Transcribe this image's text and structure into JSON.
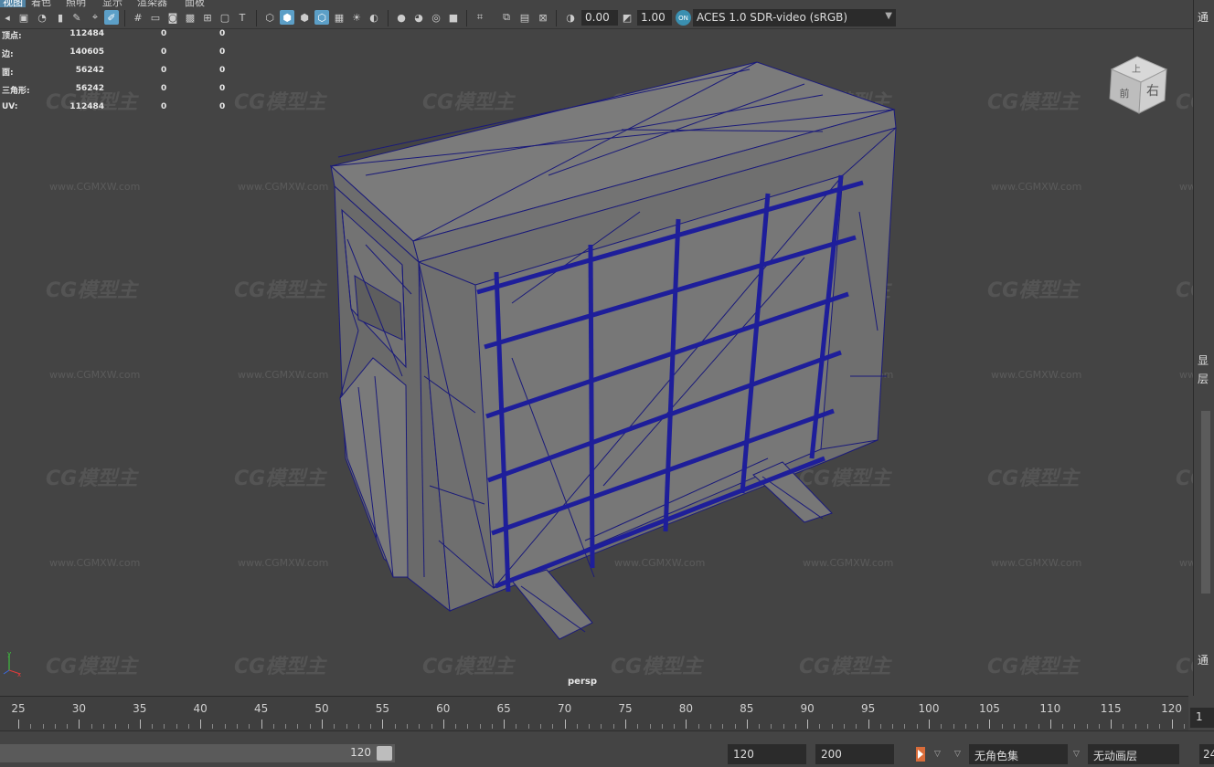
{
  "menu": {
    "items": [
      "视图",
      "着色",
      "照明",
      "显示",
      "渲染器",
      "面板"
    ]
  },
  "toolbar": {
    "exposure_value": "0.00",
    "gamma_value": "1.00",
    "color_space": "ACES 1.0 SDR-video (sRGB)",
    "color_space_icon": "aces-icon"
  },
  "hud": {
    "rows": [
      {
        "label": "顶点:",
        "v1": "112484",
        "v2": "0",
        "v3": "0"
      },
      {
        "label": "边:",
        "v1": "140605",
        "v2": "0",
        "v3": "0"
      },
      {
        "label": "面:",
        "v1": "56242",
        "v2": "0",
        "v3": "0"
      },
      {
        "label": "三角形:",
        "v1": "56242",
        "v2": "0",
        "v3": "0"
      },
      {
        "label": "UV:",
        "v1": "112484",
        "v2": "0",
        "v3": "0"
      }
    ]
  },
  "viewport": {
    "camera_label": "persp",
    "watermark_text": "CG模型主",
    "watermark_url": "www.CGMXW.com",
    "viewcube_top": "上",
    "viewcube_front": "前",
    "viewcube_right": "右",
    "axis_x": "x",
    "axis_y": "y",
    "wire_color": "#1a1a7a",
    "grid_bar_color": "#1e1e9a"
  },
  "right_panel": {
    "labels": [
      "通",
      "显",
      "层",
      "通"
    ]
  },
  "timeline": {
    "ticks": [
      "25",
      "30",
      "35",
      "40",
      "45",
      "50",
      "55",
      "60",
      "65",
      "70",
      "75",
      "80",
      "85",
      "90",
      "95",
      "100",
      "105",
      "110",
      "115",
      "120"
    ],
    "current_frame": "1"
  },
  "range": {
    "range_end": "120",
    "end_field": "120",
    "max_field": "200",
    "char_set": "无角色集",
    "anim_layer": "无动画层",
    "fps_partial": "24"
  }
}
